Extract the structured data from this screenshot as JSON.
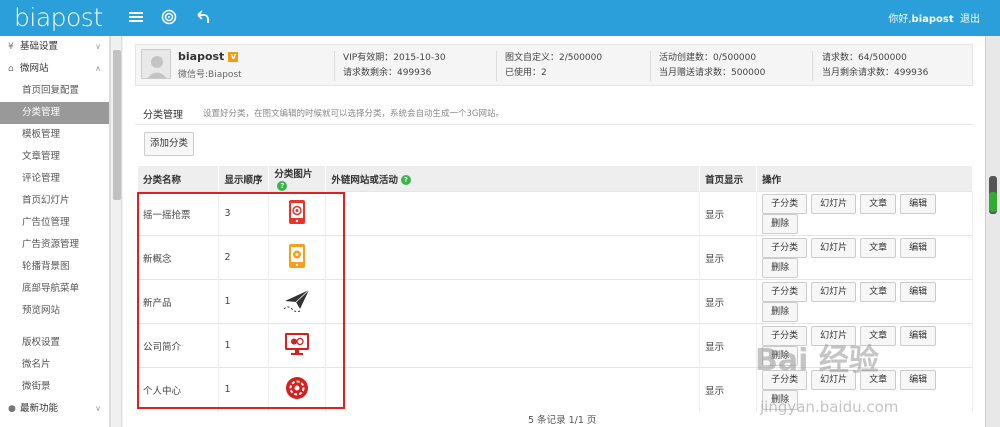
{
  "header": {
    "logo": "biapost",
    "greeting": "你好,",
    "username": "biapost",
    "logout": "退出"
  },
  "sidebar": {
    "group_basic": "基础设置",
    "group_site": "微网站",
    "items": [
      {
        "label": "首页回复配置"
      },
      {
        "label": "分类管理"
      },
      {
        "label": "模板管理"
      },
      {
        "label": "文章管理"
      },
      {
        "label": "评论管理"
      },
      {
        "label": "首页幻灯片"
      },
      {
        "label": "广告位管理"
      },
      {
        "label": "广告资源管理"
      },
      {
        "label": "轮播背景图"
      },
      {
        "label": "底部导航菜单"
      },
      {
        "label": "预览网站"
      }
    ],
    "items2": [
      {
        "label": "版权设置"
      },
      {
        "label": "微名片"
      },
      {
        "label": "微街景"
      }
    ],
    "group_new": "最新功能"
  },
  "info": {
    "name": "biapost",
    "vip_badge": "V",
    "wechat": "微信号:Biapost",
    "vip_expire": "VIP有效期：2015-10-30",
    "req_left": "请求数剩余：499936",
    "custom_text": "图文自定义：2/500000",
    "used": "已使用：2",
    "activity": "活动创建数：0/500000",
    "gift_req": "当月赠送请求数：500000",
    "req_count": "请求数：64/500000",
    "month_left": "当月剩余请求数：499936"
  },
  "section": {
    "title": "分类管理",
    "desc": "设置好分类，在图文编辑的时候就可以选择分类，系统会自动生成一个3G网站。",
    "add_button": "添加分类"
  },
  "table": {
    "headers": {
      "name": "分类名称",
      "order": "显示顺序",
      "pic": "分类图片",
      "link": "外链网站或活动",
      "home": "首页显示",
      "ops": "操作"
    },
    "rows": [
      {
        "name": "摇一摇抢票",
        "order": "3",
        "home": "显示",
        "icon": "phone-shake-icon"
      },
      {
        "name": "新概念",
        "order": "2",
        "home": "显示",
        "icon": "phone-orange-icon"
      },
      {
        "name": "新产品",
        "order": "1",
        "home": "显示",
        "icon": "paper-plane-icon"
      },
      {
        "name": "公司简介",
        "order": "1",
        "home": "显示",
        "icon": "monitor-icon"
      },
      {
        "name": "个人中心",
        "order": "1",
        "home": "显示",
        "icon": "gear-red-icon"
      }
    ],
    "ops": {
      "sub": "子分类",
      "slide": "幻灯片",
      "article": "文章",
      "edit": "编辑",
      "delete": "删除"
    }
  },
  "pager": "5 条记录 1/1 页",
  "watermark": "Bai 经验",
  "watermark_sub": "jingyan.baidu.com"
}
